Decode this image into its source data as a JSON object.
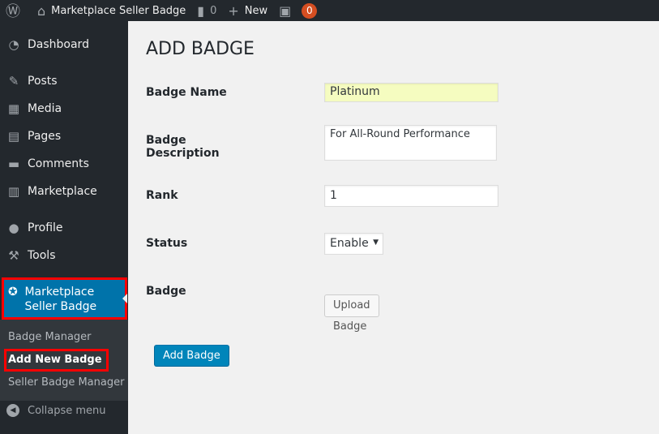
{
  "adminbar": {
    "site": "Marketplace Seller Badge",
    "comments": "0",
    "new": "New",
    "notifications": "0"
  },
  "menu": [
    "Dashboard",
    "Posts",
    "Media",
    "Pages",
    "Comments",
    "Marketplace",
    "Profile",
    "Tools"
  ],
  "current": "Marketplace Seller Badge",
  "submenu": [
    "Badge Manager",
    "Add New Badge",
    "Seller Badge Manager"
  ],
  "collapse": "Collapse menu",
  "page": {
    "title": "ADD BADGE",
    "labels": {
      "name": "Badge Name",
      "desc": "Badge Description",
      "rank": "Rank",
      "status": "Status",
      "badge": "Badge"
    },
    "values": {
      "name": "Platinum",
      "desc": "For All-Round Performance",
      "rank": "1",
      "status": "Enable"
    },
    "upload": "Upload Badge",
    "submit": "Add Badge"
  }
}
